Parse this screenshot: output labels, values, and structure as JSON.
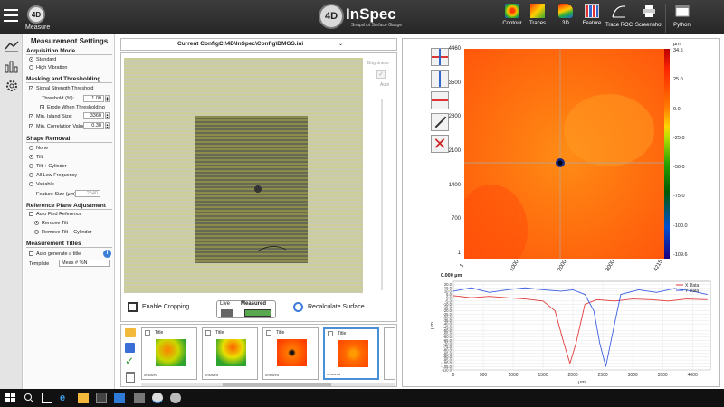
{
  "app": {
    "measure_badge": "4D",
    "measure_label": "Measure",
    "logo_badge": "4D",
    "logo_name": "InSpec",
    "logo_sub": "Snapshot Surface Gauge"
  },
  "toolbar": {
    "contour": "Contour",
    "traces": "Traces",
    "three_d": "3D",
    "feature": "Feature",
    "trace_roc": "Trace ROC",
    "screenshot": "Screenshot",
    "python": "Python"
  },
  "settings": {
    "title": "Measurement Settings",
    "acq_title": "Acquisition Mode",
    "acq_standard": "Standard",
    "acq_high_vib": "High Vibration",
    "mask_title": "Masking and Thresholding",
    "signal_strength": "Signal Strength Threshold",
    "threshold_label": "Threshold (%):",
    "threshold_value": "1.00",
    "erode": "Erode When Thresholding",
    "min_island_label": "Min. Island Size:",
    "min_island_value": "3360",
    "min_corr_label": "Min. Correlation Value:",
    "min_corr_value": "0.30",
    "shape_title": "Shape Removal",
    "shape_none": "None",
    "shape_tilt": "Tilt",
    "shape_tilt_cyl": "Tilt + Cylinder",
    "shape_all_low": "All Low Frequency",
    "shape_variable": "Variable",
    "feature_size_label": "Feature Size (µm)",
    "feature_size_value": "2540",
    "ref_title": "Reference Plane Adjustment",
    "auto_find": "Auto Find Reference",
    "remove_tilt": "Remove Tilt",
    "remove_tilt_cyl": "Remove Tilt + Cylinder",
    "titles_title": "Measurement Titles",
    "auto_gen": "Auto generate a title",
    "template_label": "Template",
    "template_value": "Meas # %N"
  },
  "config": {
    "label": "Current Config:",
    "value": "C:\\4D\\InSpec\\Config\\DMGS.ini",
    "dropdown": "⌄"
  },
  "image": {
    "brightness": "Brightness",
    "auto": "Auto",
    "enable_cropping": "Enable Cropping",
    "live": "Live",
    "measured": "Measured",
    "recalc": "Recalculate Surface"
  },
  "thumbnails": [
    {
      "title": "Title",
      "status": "unsaved"
    },
    {
      "title": "Title",
      "status": "unsaved"
    },
    {
      "title": "Title",
      "status": "unsaved"
    },
    {
      "title": "Title",
      "status": "unsaved"
    }
  ],
  "heatmap": {
    "y_ticks": [
      "4460",
      "3500",
      "2800",
      "2100",
      "1400",
      "700",
      "1"
    ],
    "x_ticks": [
      "1",
      "1000",
      "2000",
      "3000",
      "4215"
    ],
    "cb_unit": "µm",
    "cb_ticks": [
      "34.5",
      "25.0",
      "0.0",
      "-25.0",
      "-50.0",
      "-75.0",
      "-100.0",
      "-109.6"
    ]
  },
  "chart_data": {
    "type": "line",
    "title": "0.000 µm",
    "xlabel": "µm",
    "ylabel": "µm",
    "xlim": [
      0,
      4300
    ],
    "ylim": [
      -110,
      25
    ],
    "x_ticks": [
      0,
      500,
      1000,
      1500,
      2000,
      2500,
      3000,
      3500,
      4000
    ],
    "y_ticks": [
      20,
      15,
      10,
      5,
      0,
      -5,
      -10,
      -15,
      -20,
      -25,
      -30,
      -35,
      -40,
      -45,
      -50,
      -55,
      -60,
      -65,
      -70,
      -75,
      -80,
      -85,
      -90,
      -95,
      -100,
      -105,
      -110
    ],
    "legend_position": "top-right",
    "series": [
      {
        "name": "X Data",
        "color": "#e23b3b",
        "x": [
          0,
          300,
          600,
          900,
          1200,
          1500,
          1700,
          1850,
          1950,
          2050,
          2200,
          2400,
          2700,
          3000,
          3300,
          3600,
          3900,
          4250
        ],
        "y": [
          3,
          0,
          2,
          0,
          -2,
          -5,
          -20,
          -70,
          -100,
          -70,
          -10,
          -3,
          -5,
          -2,
          -3,
          -5,
          -2,
          -3
        ]
      },
      {
        "name": "Y Data",
        "color": "#3b5fe2",
        "x": [
          0,
          300,
          600,
          900,
          1200,
          1500,
          1800,
          2000,
          2200,
          2350,
          2450,
          2550,
          2650,
          2800,
          3100,
          3400,
          3700,
          4000,
          4250
        ],
        "y": [
          10,
          15,
          8,
          12,
          15,
          12,
          10,
          12,
          5,
          -20,
          -70,
          -105,
          -60,
          5,
          12,
          8,
          14,
          10,
          5
        ]
      }
    ]
  }
}
